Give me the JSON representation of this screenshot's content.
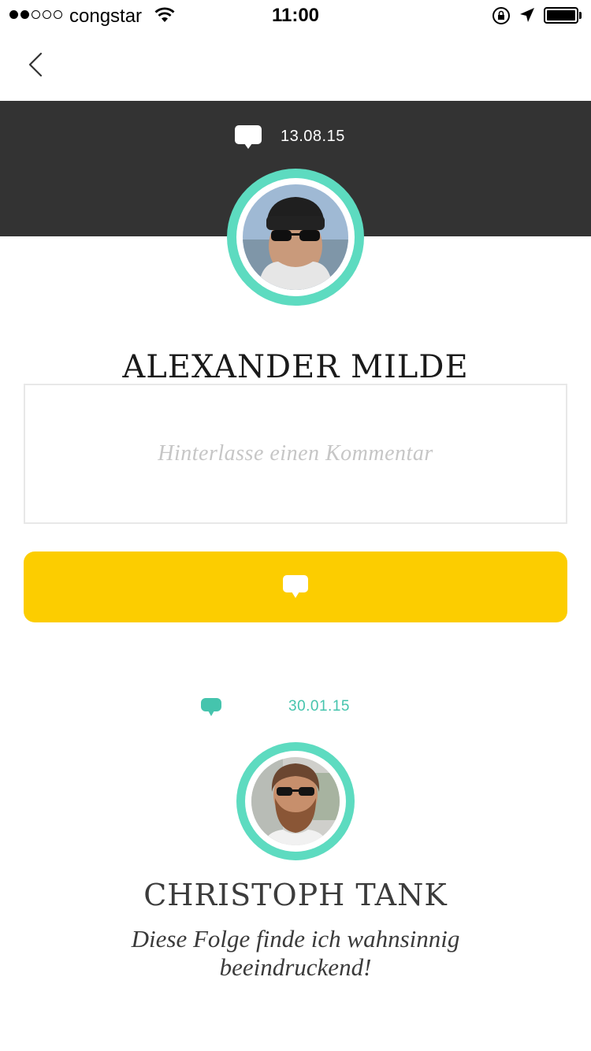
{
  "status_bar": {
    "signal_dots": [
      true,
      true,
      false,
      false,
      false
    ],
    "carrier": "congstar",
    "time": "11:00",
    "battery_level": 1.0
  },
  "nav": {
    "back_icon": "chevron-left-icon"
  },
  "header": {
    "date": "13.08.15",
    "icon": "speech-bubble-icon",
    "background_color": "#333333"
  },
  "profile": {
    "name": "ALEXANDER MILDE",
    "avatar_ring_color": "#5ddbc0"
  },
  "comment_form": {
    "placeholder": "Hinterlasse einen Kommentar",
    "value": "",
    "submit_icon": "speech-bubble-icon",
    "submit_color": "#fccd00"
  },
  "comments": [
    {
      "date": "30.01.15",
      "author": "CHRISTOPH TANK",
      "text": "Diese Folge finde ich wahnsinnig beeindruckend!",
      "accent_color": "#45c4ad"
    }
  ]
}
